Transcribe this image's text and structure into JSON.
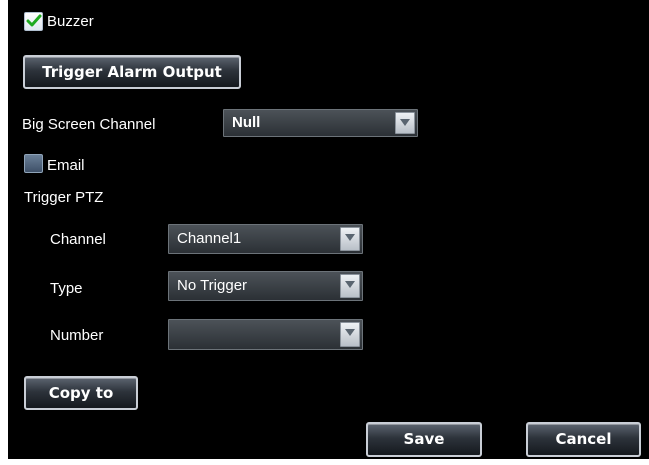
{
  "buzzer": {
    "label": "Buzzer",
    "checked": true
  },
  "trigger_alarm_output": {
    "label": "Trigger Alarm Output"
  },
  "big_screen_channel": {
    "label": "Big Screen Channel",
    "value": "Null"
  },
  "email": {
    "label": "Email",
    "checked": false
  },
  "trigger_ptz": {
    "heading": "Trigger PTZ",
    "channel": {
      "label": "Channel",
      "value": "Channel1"
    },
    "type": {
      "label": "Type",
      "value": "No Trigger"
    },
    "number": {
      "label": "Number",
      "value": ""
    }
  },
  "copy_to": {
    "label": "Copy to"
  },
  "footer": {
    "save_label": "Save",
    "cancel_label": "Cancel"
  },
  "colors": {
    "background": "#000000",
    "checkmark": "#1faa1f",
    "text": "#ffffff"
  }
}
